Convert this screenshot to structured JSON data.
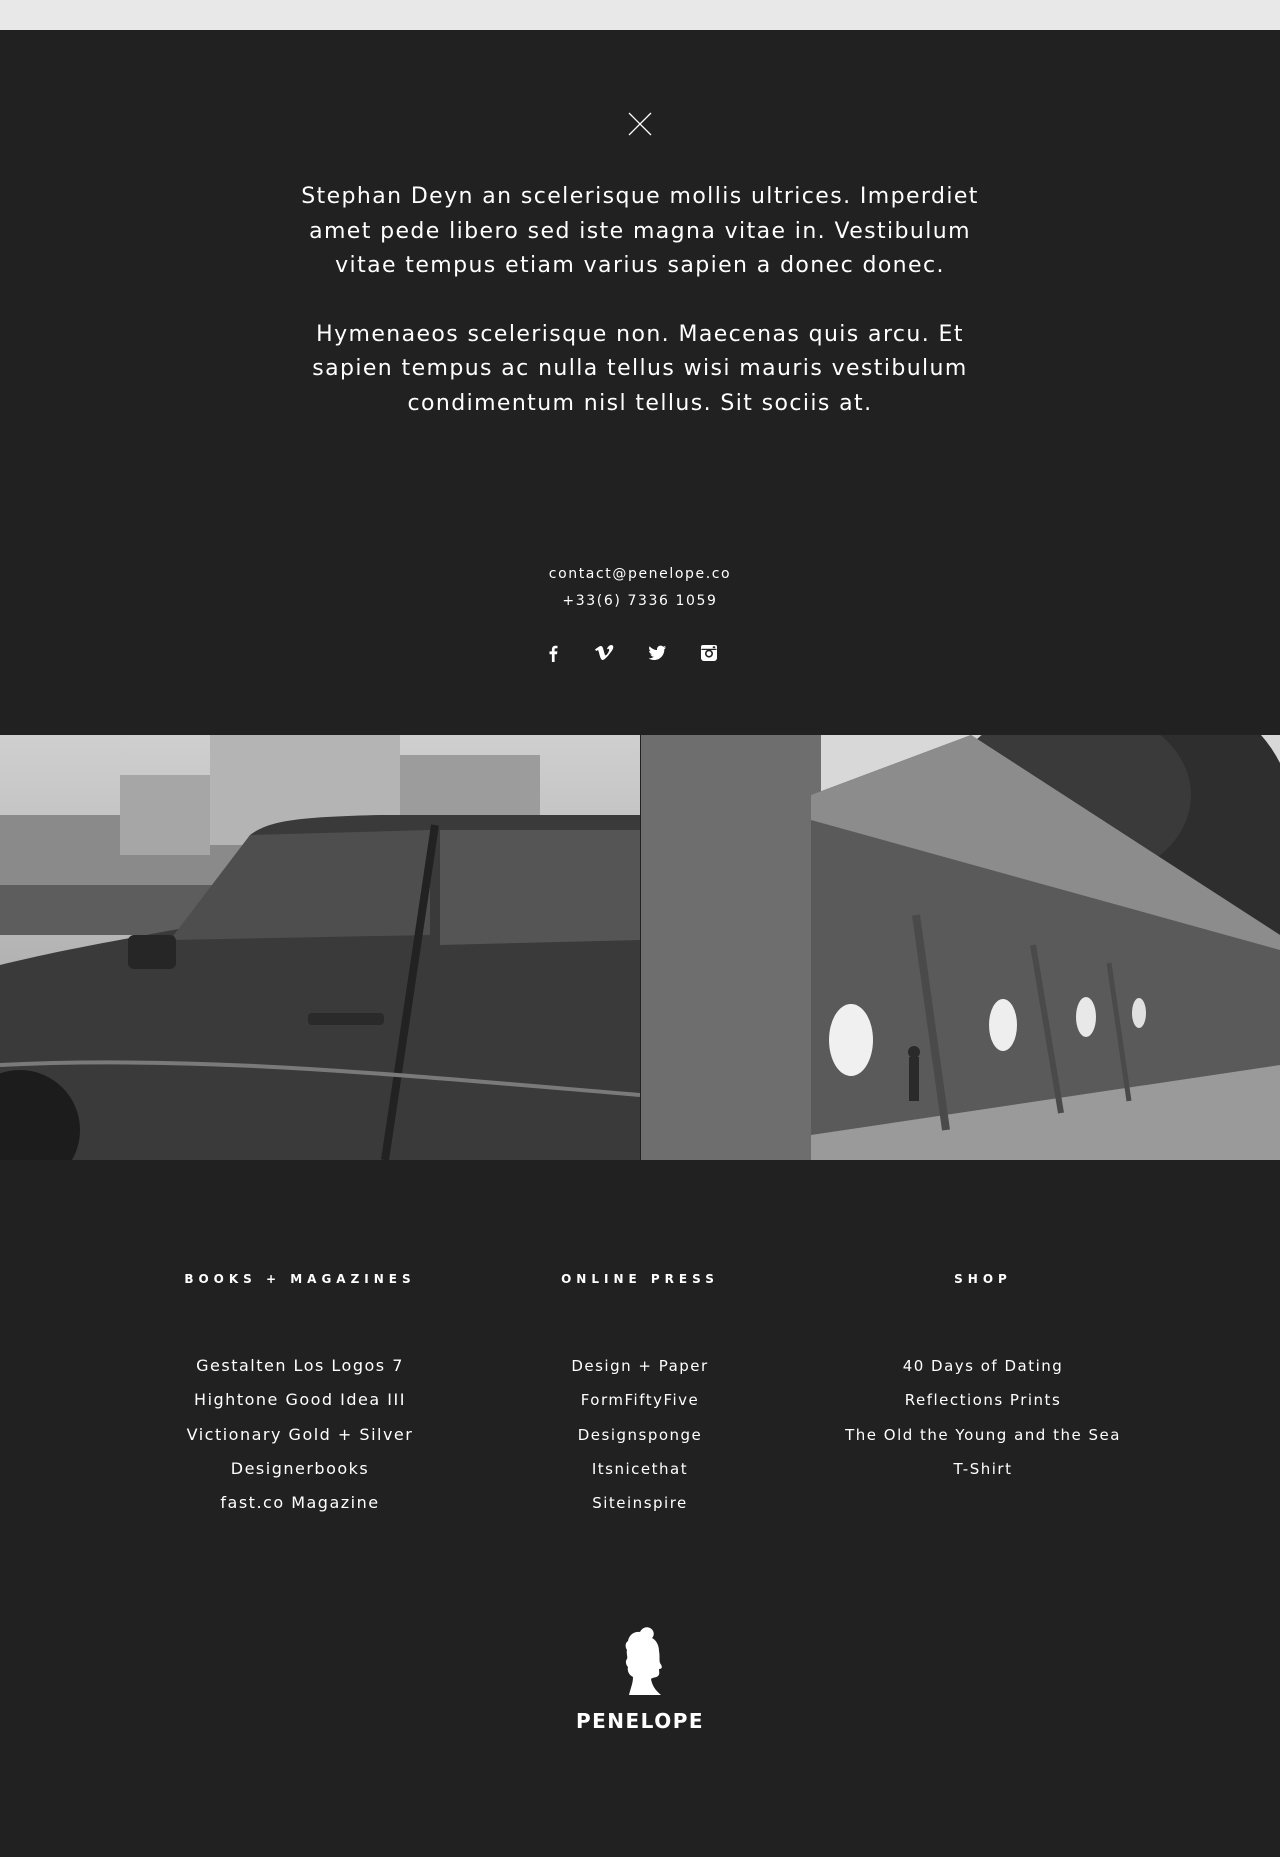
{
  "about": {
    "paragraphs": [
      "Stephan Deyn an scelerisque mollis ultrices. Imperdiet amet pede libero sed iste magna vitae in. Vestibulum vitae tempus etiam varius sapien a donec donec.",
      "Hymenaeos scelerisque non. Maecenas quis arcu. Et sapien tempus ac nulla tellus wisi mauris vestibulum condimentum nisl tellus. Sit sociis at."
    ]
  },
  "contact": {
    "email": "contact@penelope.co",
    "phone": "+33(6) 7336 1059"
  },
  "social": [
    "facebook-icon",
    "vimeo-icon",
    "twitter-icon",
    "instagram-icon"
  ],
  "columns": {
    "books": {
      "heading": "BOOKS + MAGAZINES",
      "items": [
        "Gestalten Los Logos 7",
        "Hightone Good Idea III",
        "Victionary Gold + Silver",
        "Designerbooks",
        "fast.co Magazine"
      ]
    },
    "press": {
      "heading": "ONLINE PRESS",
      "items": [
        "Design + Paper",
        "FormFiftyFive",
        "Designsponge",
        "Itsnicethat",
        "Siteinspire"
      ]
    },
    "shop": {
      "heading": "SHOP",
      "items": [
        "40 Days of Dating",
        "Reflections Prints",
        "The Old the Young and the Sea",
        "T-Shirt"
      ]
    }
  },
  "brand": {
    "name": "PENELOPE"
  },
  "colors": {
    "background": "#212121",
    "text": "#ffffff",
    "topbar": "#e8e8e8"
  }
}
